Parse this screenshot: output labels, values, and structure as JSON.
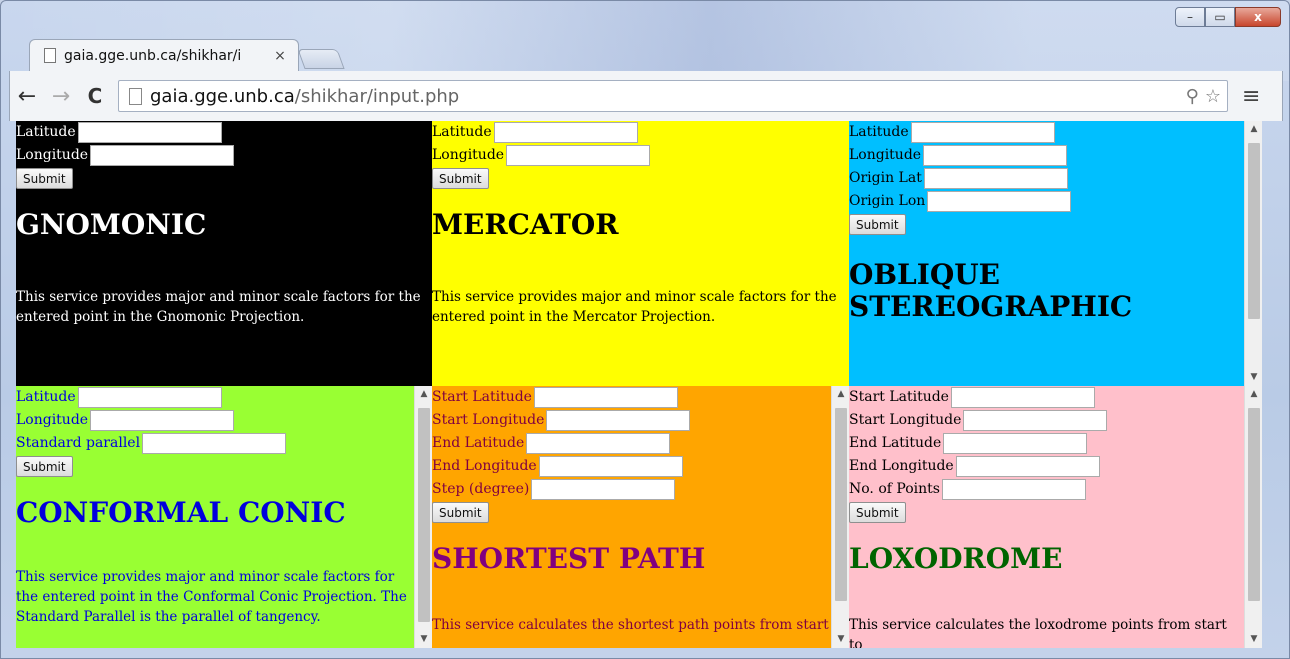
{
  "browser": {
    "tab_title": "gaia.gge.unb.ca/shikhar/i",
    "tab_close": "×",
    "url_host": "gaia.gge.unb.ca",
    "url_path": "/shikhar/input.php",
    "back": "←",
    "forward": "→",
    "reload": "C",
    "zoom_glyph": "⚲",
    "star_glyph": "☆",
    "menu_glyph": "≡",
    "win_min": "–",
    "win_max": "▭",
    "win_close": "x"
  },
  "panels": {
    "gnomonic": {
      "fields": [
        "Latitude",
        "Longitude"
      ],
      "submit": "Submit",
      "title": "GNOMONIC",
      "description": "This service provides major and minor scale factors for the entered point in the Gnomonic Projection."
    },
    "mercator": {
      "fields": [
        "Latitude",
        "Longitude"
      ],
      "submit": "Submit",
      "title": "MERCATOR",
      "description": "This service provides major and minor scale factors for the entered point in the Mercator Projection."
    },
    "oblique": {
      "fields": [
        "Latitude",
        "Longitude",
        "Origin Lat",
        "Origin Lon"
      ],
      "submit": "Submit",
      "title_line1": "OBLIQUE",
      "title_line2": "STEREOGRAPHIC"
    },
    "conic": {
      "fields": [
        "Latitude",
        "Longitude",
        "Standard parallel"
      ],
      "submit": "Submit",
      "title": "CONFORMAL CONIC",
      "description": "This service provides major and minor scale factors for the entered point in the Conformal Conic Projection. The Standard Parallel is the parallel of tangency."
    },
    "shortest": {
      "fields": [
        "Start Latitude",
        "Start Longitude",
        "End Latitude",
        "End Longitude",
        "Step (degree)"
      ],
      "submit": "Submit",
      "title": "SHORTEST PATH",
      "description": "This service calculates the shortest path points from start"
    },
    "loxodrome": {
      "fields": [
        "Start Latitude",
        "Start Longitude",
        "End Latitude",
        "End Longitude",
        "No. of Points"
      ],
      "submit": "Submit",
      "title": "LOXODROME",
      "description": "This service calculates the loxodrome points from start to"
    }
  },
  "colors": {
    "gnomonic_bg": "#000000",
    "mercator_bg": "#ffff00",
    "oblique_bg": "#00bfff",
    "conic_bg": "#99ff33",
    "shortest_bg": "#ffa500",
    "loxodrome_bg": "#ffc0cb"
  }
}
